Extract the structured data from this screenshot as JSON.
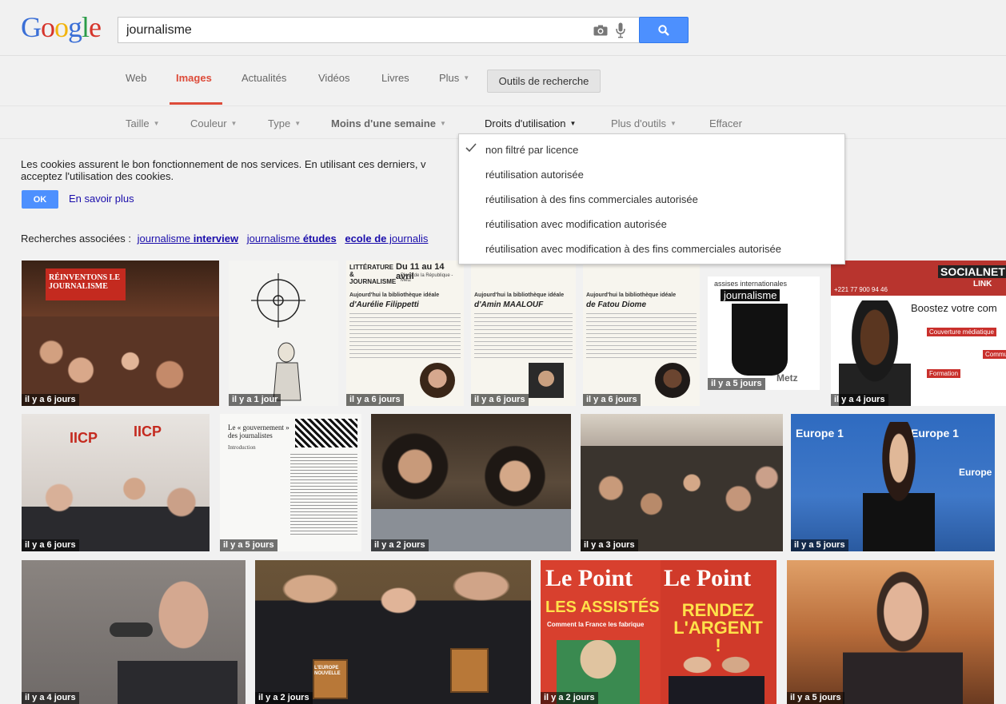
{
  "logo": [
    "G",
    "o",
    "o",
    "g",
    "l",
    "e"
  ],
  "search": {
    "value": "journalisme"
  },
  "tabs": [
    {
      "label": "Web",
      "active": false
    },
    {
      "label": "Images",
      "active": true
    },
    {
      "label": "Actualités",
      "active": false
    },
    {
      "label": "Vidéos",
      "active": false
    },
    {
      "label": "Livres",
      "active": false
    },
    {
      "label": "Plus",
      "active": false
    }
  ],
  "tools_button": "Outils de recherche",
  "filters": [
    "Taille",
    "Couleur",
    "Type",
    "Moins d'une semaine",
    "Droits d'utilisation",
    "Plus d'outils",
    "Effacer"
  ],
  "cookies": {
    "text_line1": "Les cookies assurent le bon fonctionnement de nos services. En utilisant ces derniers, v",
    "text_line2": "acceptez l'utilisation des cookies.",
    "ok_label": "OK",
    "learn_more": "En savoir plus"
  },
  "related": {
    "label": "Recherches associées :",
    "links": [
      {
        "prefix": "journalisme ",
        "bold": "interview"
      },
      {
        "prefix": "journalisme ",
        "bold": "études"
      },
      {
        "prefix": "",
        "bold": "ecole de",
        "suffix": " journalis"
      }
    ]
  },
  "dropdown": {
    "items": [
      {
        "label": "non filtré par licence",
        "checked": true
      },
      {
        "label": "réutilisation autorisée",
        "checked": false
      },
      {
        "label": "réutilisation à des fins commerciales autorisée",
        "checked": false
      },
      {
        "label": "réutilisation avec modification autorisée",
        "checked": false
      },
      {
        "label": "réutilisation avec modification à des fins commerciales autorisée",
        "checked": false
      }
    ]
  },
  "images": [
    {
      "time": "il y a 6 jours",
      "color": "#7a3b2a"
    },
    {
      "time": "il y a 1 jour",
      "color": "#f4f4f2"
    },
    {
      "time": "il y a 6 jours",
      "color": "#f7f5ee"
    },
    {
      "time": "il y a 6 jours",
      "color": "#f7f5ee"
    },
    {
      "time": "il y a 6 jours",
      "color": "#f7f5ee"
    },
    {
      "time": "il y a 5 jours",
      "color": "#ffffff"
    },
    {
      "time": "il y a 4 jours",
      "color": "#b8342e"
    },
    {
      "time": "il y a 6 jours",
      "color": "#8a4040"
    },
    {
      "time": "il y a 5 jours",
      "color": "#f8f8f6"
    },
    {
      "time": "il y a 2 jours",
      "color": "#4a3c30"
    },
    {
      "time": "il y a 3 jours",
      "color": "#9a8d82"
    },
    {
      "time": "il y a 5 jours",
      "color": "#3f78c8"
    },
    {
      "time": "il y a 4 jours",
      "color": "#6f6a68"
    },
    {
      "time": "il y a 2 jours",
      "color": "#5a4632"
    },
    {
      "time": "il y a 2 jours",
      "color": "#d8402e"
    },
    {
      "time": "il y a 5 jours",
      "color": "#b86c3a"
    }
  ],
  "image_texts": {
    "inventons": "RÉINVENTONS LE JOURNALISME",
    "litterature": "LITTÉRATURE & JOURNALISME",
    "date_range": "Du 11 au 14 avril",
    "place": "Place de la République - Metz",
    "biblio": "Aujourd'hui la bibliothèque idéale",
    "person1": "d'Aurélie Filippetti",
    "person2": "d'Amin MAALOUF",
    "person3": "de Fatou Diome",
    "assises": "assises internationales",
    "journalisme": "journalisme",
    "metz": "Metz",
    "socialnet": "SOCIALNET",
    "link": "LINK",
    "phone": "+221 77 900 94 46",
    "boostez": "Boostez votre com",
    "couverture": "Couverture médiatique",
    "communication": "Communication",
    "formation": "Formation",
    "iicp": "IICP",
    "gouvernement": "Le « gouvernement » des journalistes",
    "introduction": "Introduction",
    "europe1": "Europe 1",
    "europe": "Europe",
    "lepoint": "Le Point",
    "assistes": "LES ASSISTÉS",
    "fabrique": "Comment la France les fabrique",
    "rendez": "RENDEZ L'ARGENT !",
    "europe_nouvelle": "L'EUROPE NOUVELLE"
  }
}
